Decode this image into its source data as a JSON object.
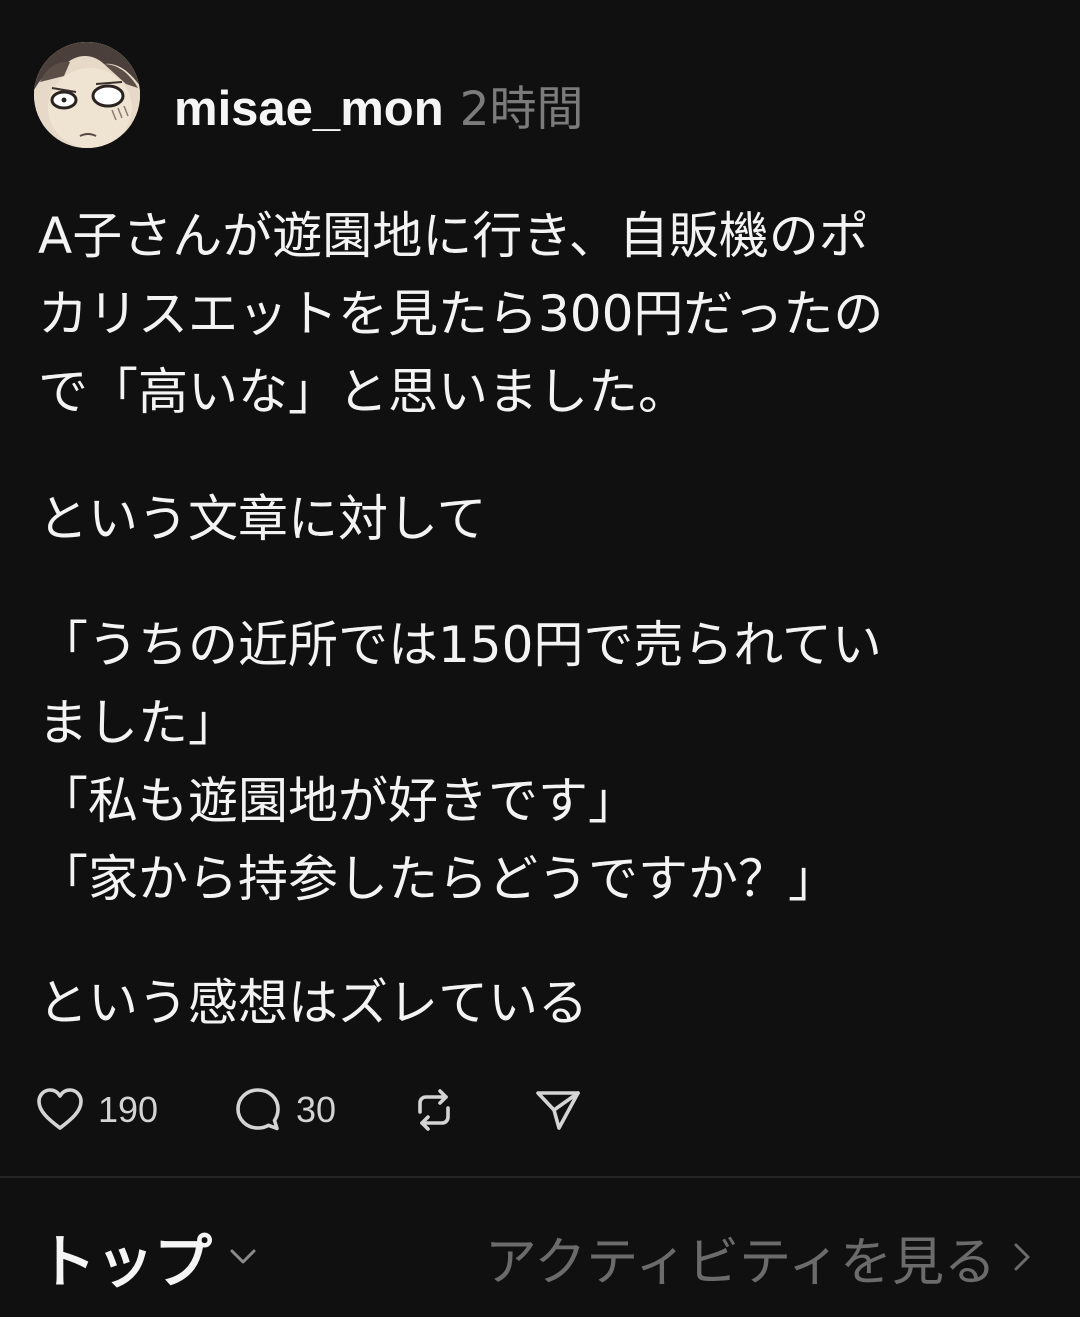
{
  "post": {
    "username": "misae_mon",
    "timestamp": "2時間",
    "paragraphs": [
      [
        "A子さんが遊園地に行き、自販機のポ",
        "カリスエットを見たら300円だったの",
        "で「高いな」と思いました。"
      ],
      [
        "という文章に対して"
      ],
      [
        "「うちの近所では150円で売られてい",
        "ました」",
        "「私も遊園地が好きです」",
        "「家から持参したらどうですか？」"
      ],
      [
        "という感想はズレている"
      ]
    ],
    "actions": {
      "like_count": "190",
      "reply_count": "30",
      "like_icon": "heart-icon",
      "reply_icon": "speech-bubble-icon",
      "repost_icon": "repost-icon",
      "share_icon": "send-icon"
    }
  },
  "footer": {
    "title": "トップ",
    "activity_link": "アクティビティを見る"
  },
  "colors": {
    "background": "#101010",
    "text": "#f3f3f3",
    "muted": "#7b7b7b",
    "divider": "#262626"
  }
}
